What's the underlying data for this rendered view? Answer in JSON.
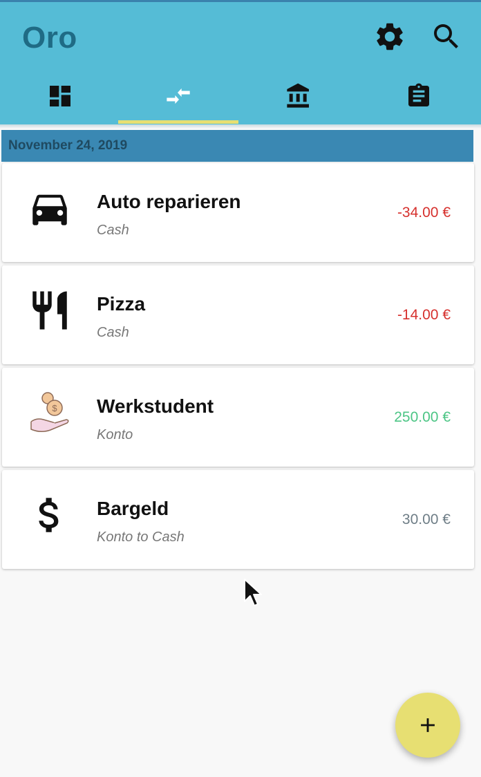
{
  "app": {
    "title": "Oro",
    "actions": [
      {
        "icon": "gear-icon"
      },
      {
        "icon": "search-icon"
      }
    ],
    "tabs": [
      {
        "icon": "dashboard-icon",
        "selected": false
      },
      {
        "icon": "transfer-arrows-icon",
        "selected": true
      },
      {
        "icon": "bank-icon",
        "selected": false
      },
      {
        "icon": "clipboard-icon",
        "selected": false
      }
    ],
    "colors": {
      "appbar": "#55bcd6",
      "title": "#1f6b85",
      "tab_indicator": "#e7df72",
      "date_header": "#3a88b3",
      "negative_amount": "#d6302d",
      "positive_amount": "#4cc585",
      "neutral_amount": "#6e7d86",
      "fab": "#e7df72"
    }
  },
  "date_header": "November 24, 2019",
  "transactions": [
    {
      "icon": "car-icon",
      "title": "Auto reparieren",
      "account": "Cash",
      "amount": "-34.00 €"
    },
    {
      "icon": "cutlery-icon",
      "title": "Pizza",
      "account": "Cash",
      "amount": "-14.00 €"
    },
    {
      "icon": "money-hand-icon",
      "title": "Werkstudent",
      "account": "Konto",
      "amount": "250.00 €"
    },
    {
      "icon": "dollar-icon",
      "title": "Bargeld",
      "account": "Konto to Cash",
      "amount": "30.00 €"
    }
  ],
  "fab": {
    "icon": "plus-icon"
  }
}
